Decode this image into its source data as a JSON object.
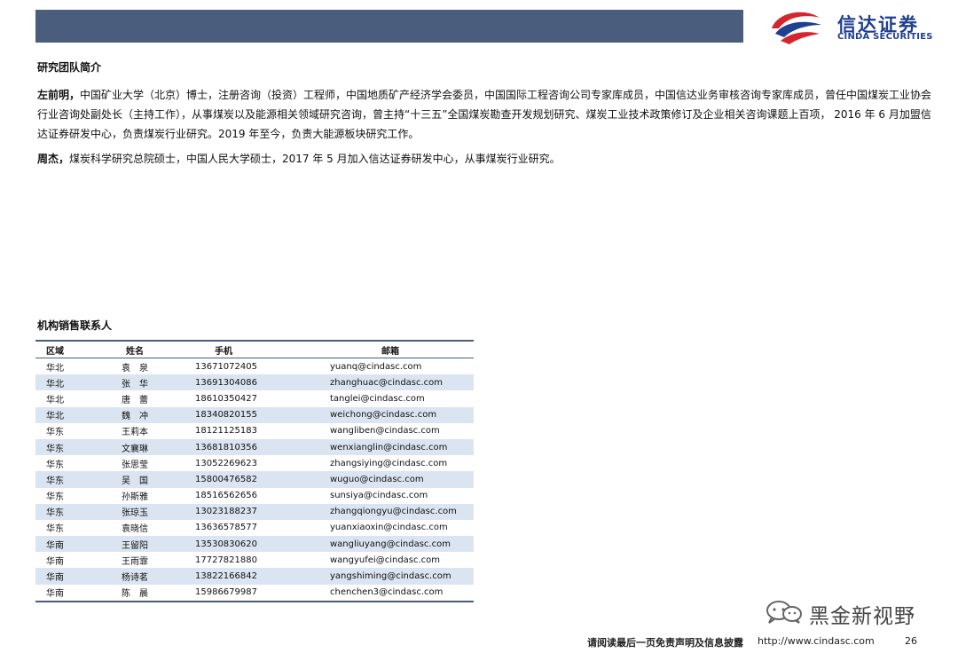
{
  "header": {
    "logo_cn": "信达证券",
    "logo_en": "CINDA SECURITIES",
    "logo_mark_icon": "cinda-swirl-logo-icon",
    "accent_color": "#4a5d7d",
    "brand_color": "#1f3f8f",
    "logo_red": "#d6262d"
  },
  "team": {
    "title": "研究团队简介",
    "members": [
      {
        "name": "左前明，",
        "bio": "中国矿业大学（北京）博士，注册咨询（投资）工程师，中国地质矿产经济学会委员，中国国际工程咨询公司专家库成员，中国信达业务审核咨询专家库成员，曾任中国煤炭工业协会行业咨询处副处长（主持工作），从事煤炭以及能源相关领域研究咨询，曾主持“十三五”全国煤炭勘查开发规划研究、煤炭工业技术政策修订及企业相关咨询课题上百项， 2016 年 6 月加盟信达证券研发中心，负责煤炭行业研究。2019 年至今，负责大能源板块研究工作。"
      },
      {
        "name": "周杰，",
        "bio": "煤炭科学研究总院硕士，中国人民大学硕士，2017 年 5 月加入信达证券研发中心，从事煤炭行业研究。"
      }
    ]
  },
  "sales": {
    "title": "机构销售联系人",
    "headers": [
      "区域",
      "姓名",
      "手机",
      "邮箱"
    ],
    "rows": [
      [
        "华北",
        "袁　泉",
        "13671072405",
        "yuanq@cindasc.com"
      ],
      [
        "华北",
        "张　华",
        "13691304086",
        "zhanghuac@cindasc.com"
      ],
      [
        "华北",
        "唐　蕾",
        "18610350427",
        "tanglei@cindasc.com"
      ],
      [
        "华北",
        "魏　冲",
        "18340820155",
        "weichong@cindasc.com"
      ],
      [
        "华东",
        "王莉本",
        "18121125183",
        "wangliben@cindasc.com"
      ],
      [
        "华东",
        "文襄琳",
        "13681810356",
        "wenxianglin@cindasc.com"
      ],
      [
        "华东",
        "张思莹",
        "13052269623",
        "zhangsiying@cindasc.com"
      ],
      [
        "华东",
        "吴　国",
        "15800476582",
        "wuguo@cindasc.com"
      ],
      [
        "华东",
        "孙斯雅",
        "18516562656",
        "sunsiya@cindasc.com"
      ],
      [
        "华东",
        "张琼玉",
        "13023188237",
        "zhangqiongyu@cindasc.com"
      ],
      [
        "华东",
        "袁晓信",
        "13636578577",
        "yuanxiaoxin@cindasc.com"
      ],
      [
        "华南",
        "王留阳",
        "13530830620",
        "wangliuyang@cindasc.com"
      ],
      [
        "华南",
        "王雨霏",
        "17727821880",
        "wangyufei@cindasc.com"
      ],
      [
        "华南",
        "杨诗茗",
        "13822166842",
        "yangshiming@cindasc.com"
      ],
      [
        "华南",
        "陈　晨",
        "15986679987",
        "chenchen3@cindasc.com"
      ]
    ]
  },
  "watermark": {
    "text": "黑金新视野",
    "icon": "wechat-icon"
  },
  "footer": {
    "disclaimer": "请阅读最后一页免责声明及信息披露",
    "url": "http://www.cindasc.com",
    "page_number": "26"
  }
}
